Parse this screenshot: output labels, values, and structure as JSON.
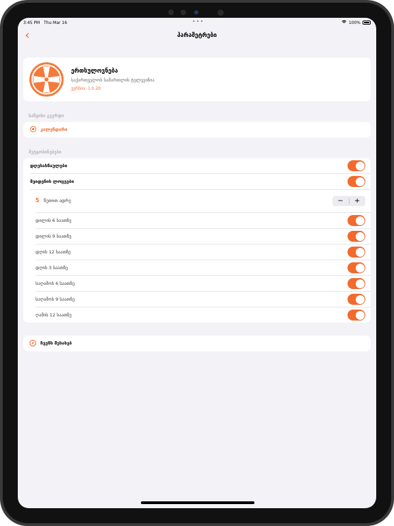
{
  "status_bar": {
    "time": "3:45 PM",
    "date": "Thu Mar 16",
    "multitask_dots": "•••",
    "battery": "100%"
  },
  "nav": {
    "back_glyph": "‹",
    "title": "პარამეტრები"
  },
  "app_info": {
    "name": "ერთსულოვნება",
    "subtitle": "საქართველოს სამართლის ტელევიზია",
    "version": "ვერსია: 1.0.20"
  },
  "home_section": {
    "header": "საწყისი გვერდი",
    "item": {
      "label": "კალენდარი",
      "icon": "radio-target-icon"
    }
  },
  "notifications": {
    "header": "შეტყობინებები",
    "holidays": {
      "label": "დღესასწაულები",
      "on": true
    },
    "prayer_times": {
      "label": "მეიდენის ლოცვები",
      "on": true
    },
    "reminder": {
      "minutes": "5",
      "label": "წუთით ადრე",
      "minus": "−",
      "plus": "+"
    },
    "times": [
      {
        "label": "დილის 6 საათზე",
        "on": true
      },
      {
        "label": "დილის 9 საათზე",
        "on": true
      },
      {
        "label": "დღის 12 საათზე",
        "on": true
      },
      {
        "label": "დღის 3 საათზე",
        "on": true
      },
      {
        "label": "საღამოს 6 საათზე",
        "on": true
      },
      {
        "label": "საღამოს 9 საათზე",
        "on": true
      },
      {
        "label": "ღამის 12 საათზე",
        "on": true
      }
    ]
  },
  "contact": {
    "label": "ჩვენს შესახებ",
    "icon": "compass-icon"
  },
  "colors": {
    "accent": "#f26b2d",
    "background": "#f2f2f7"
  }
}
